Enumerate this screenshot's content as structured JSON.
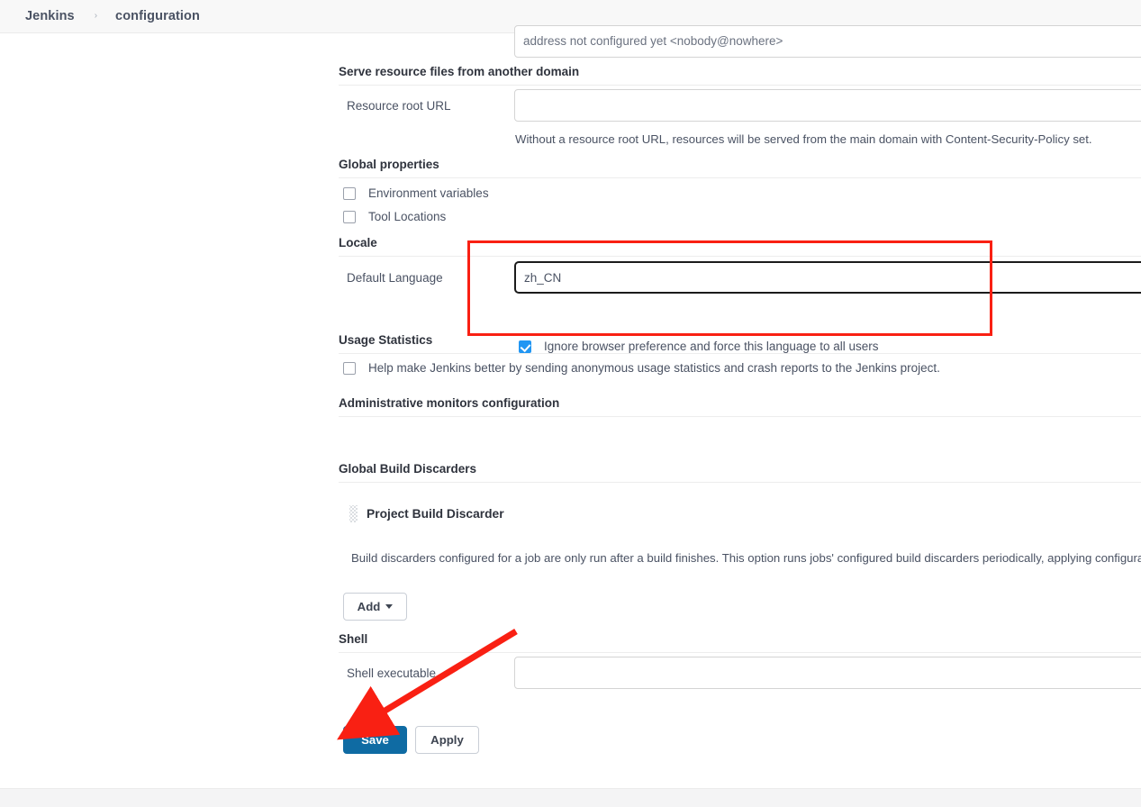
{
  "window": {
    "title": "Jenkins configuration"
  },
  "breadcrumb": {
    "root": "Jenkins",
    "separator": "›",
    "current": "configuration"
  },
  "clipped_top_field": {
    "value": "address not configured yet <nobody@nowhere>"
  },
  "sections": {
    "serve_resource": {
      "title": "Serve resource files from another domain",
      "resource_root_url": {
        "label": "Resource root URL",
        "value": "",
        "help": "Without a resource root URL, resources will be served from the main domain with Content-Security-Policy set."
      }
    },
    "global_properties": {
      "title": "Global properties",
      "checkboxes": [
        {
          "label": "Environment variables",
          "checked": false
        },
        {
          "label": "Tool Locations",
          "checked": false
        }
      ]
    },
    "locale": {
      "title": "Locale",
      "default_language": {
        "label": "Default Language",
        "value": "zh_CN",
        "focused": true
      },
      "force_language": {
        "label": "Ignore browser preference and force this language to all users",
        "checked": true
      }
    },
    "usage_statistics": {
      "title": "Usage Statistics",
      "opt_in": {
        "label": "Help make Jenkins better by sending anonymous usage statistics and crash reports to the Jenkins project.",
        "checked": false
      }
    },
    "admin_monitors": {
      "title": "Administrative monitors configuration"
    },
    "global_build_discarders": {
      "title": "Global Build Discarders",
      "entry": {
        "name": "Project Build Discarder",
        "description": "Build discarders configured for a job are only run after a build finishes. This option runs jobs' configured build discarders periodically, applying configuration changes",
        "grip_icon": "drag-handle-icon"
      },
      "add_button": {
        "label": "Add",
        "caret_icon": "chevron-down-icon"
      }
    },
    "shell": {
      "title": "Shell",
      "shell_executable": {
        "label": "Shell executable",
        "value": ""
      }
    }
  },
  "form_actions": {
    "save_label": "Save",
    "apply_label": "Apply"
  },
  "annotations": {
    "highlight_box": {
      "name": "locale-highlight-rectangle",
      "color": "#f92013"
    },
    "arrow": {
      "name": "save-button-arrow",
      "color": "#f92013",
      "points": "from upper-right to Save button"
    }
  },
  "colors": {
    "accent_blue": "#0f6ba3",
    "checkbox_blue": "#2196f3",
    "annotation_red": "#f92013",
    "breadcrumb_bg": "#f8f8f8",
    "text": "#4a5263",
    "heading": "#2f333d",
    "border": "#d4d4d4"
  }
}
